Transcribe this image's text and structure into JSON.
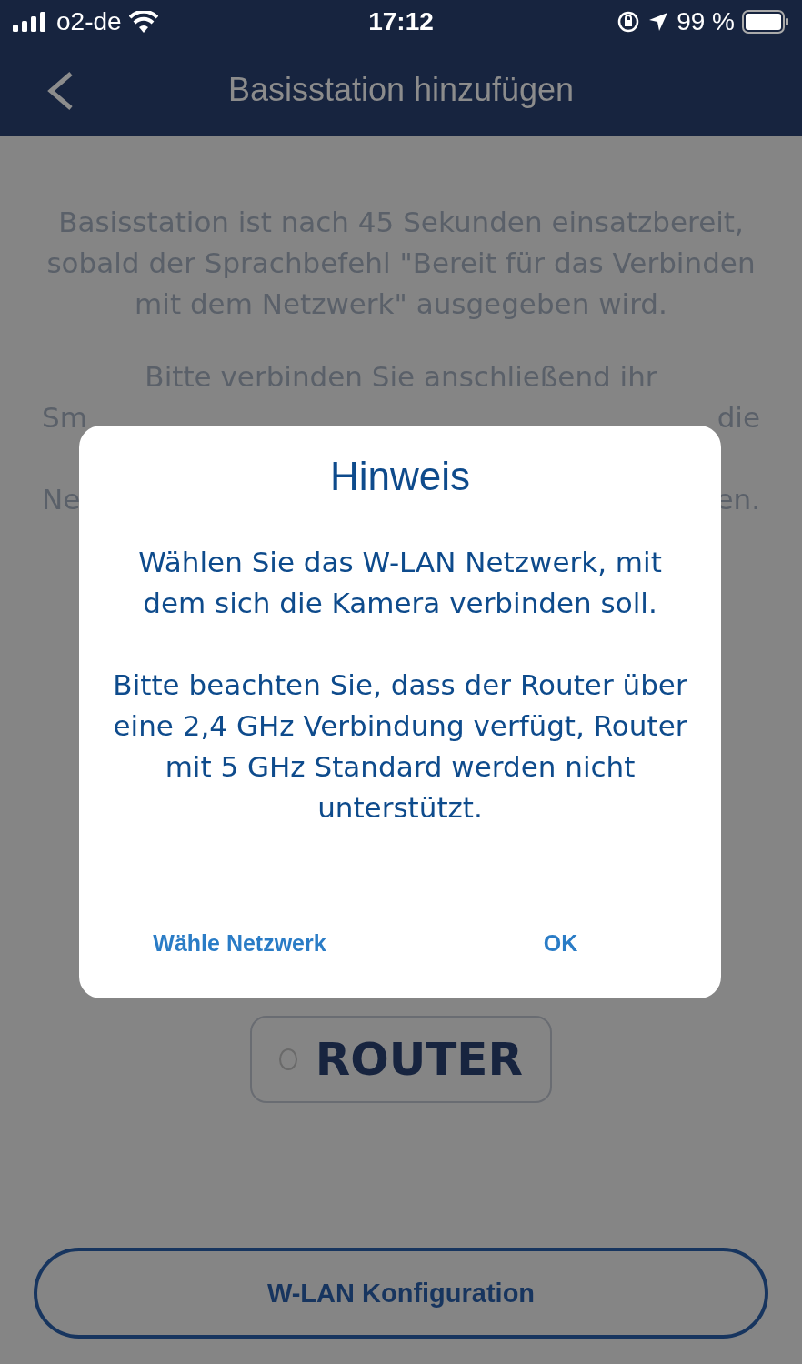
{
  "status_bar": {
    "carrier": "o2-de",
    "time": "17:12",
    "battery": "99 %"
  },
  "header": {
    "title": "Basisstation hinzufügen"
  },
  "instructions": {
    "paragraph": "Basisstation ist nach 45 Sekunden einsatzbereit, sobald der Sprachbefehl \"Bereit für das Verbinden mit dem Netzwerk\" ausgegeben wird.",
    "covered_first_line": "Bitte verbinden Sie anschließend ihr",
    "covered_lines": [
      {
        "left": "Sm",
        "right": "die"
      },
      {
        "left": "Ne",
        "right": "en."
      }
    ]
  },
  "router_option": {
    "label": "ROUTER",
    "selected": false
  },
  "dialog": {
    "title": "Hinweis",
    "messages": [
      "Wählen Sie das W-LAN Netzwerk, mit dem sich die Kamera verbinden soll.",
      "Bitte beachten Sie, dass der Router über eine 2,4 GHz Verbindung verfügt, Router mit 5 GHz Standard werden nicht unterstützt."
    ],
    "buttons": [
      {
        "label": "Wähle Netzwerk"
      },
      {
        "label": "OK"
      }
    ]
  },
  "bottom_button": {
    "label": "W-LAN Konfiguration"
  }
}
